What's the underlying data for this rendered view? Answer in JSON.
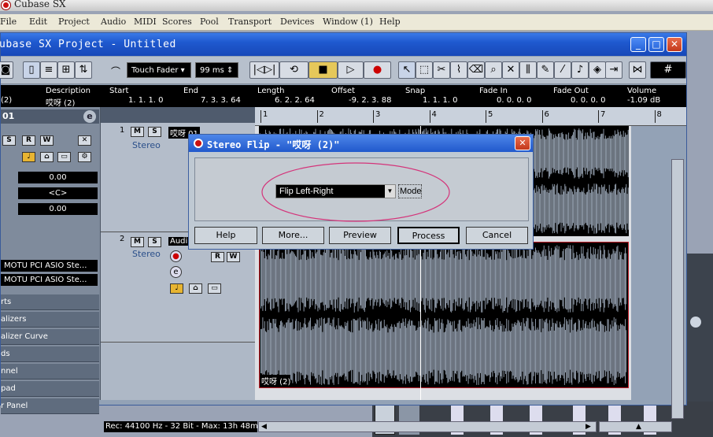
{
  "app": {
    "title": "Cubase SX"
  },
  "menu": [
    "File",
    "Edit",
    "Project",
    "Audio",
    "MIDI",
    "Scores",
    "Pool",
    "Transport",
    "Devices",
    "Window (1)",
    "Help"
  ],
  "project_window": {
    "title": "ubase SX Project - Untitled",
    "buttons": {
      "minimize": "_",
      "maximize": "□",
      "close": "✕"
    }
  },
  "toolbar": {
    "automation_mode": "Touch Fader",
    "auto_quantize": "99 ms",
    "icons": [
      "rewind-icon",
      "cycle-icon",
      "stop-icon",
      "play-icon",
      "record-icon",
      "pointer-icon",
      "range-icon",
      "split-icon",
      "glue-icon",
      "erase-icon",
      "zoom-icon",
      "mute-icon",
      "time-warp-icon",
      "draw-icon",
      "line-icon",
      "play-tool-icon",
      "color-icon",
      "snap-icon",
      "grid-icon"
    ]
  },
  "infoline": {
    "headers": {
      "description": "Description",
      "start": "Start",
      "end": "End",
      "length": "Length",
      "offset": "Offset",
      "snap": "Snap",
      "fade_in": "Fade In",
      "fade_out": "Fade Out",
      "volume": "Volume"
    },
    "values": {
      "id": "(2)",
      "description": "哎呀 (2)",
      "start": "1. 1. 1. 0",
      "end": "7. 3. 3. 64",
      "length": "6. 2. 2. 64",
      "offset": "-9. 2. 3. 88",
      "snap": "1. 1. 1. 0",
      "fade_in": "0. 0. 0. 0",
      "fade_out": "0. 0. 0. 0",
      "volume": "-1.09 dB"
    }
  },
  "inspector": {
    "track_number": "01",
    "fader_values": [
      "0.00",
      "<C>",
      "0.00"
    ],
    "outputs": [
      "MOTU PCI ASIO Ste...",
      "MOTU PCI ASIO Ste..."
    ],
    "sections": [
      "rts",
      "alizers",
      "alizer Curve",
      "ds",
      "nnel",
      "pad",
      "r Panel"
    ]
  },
  "tracks": [
    {
      "number": "1",
      "type": "Stereo",
      "name": "哎呀 01"
    },
    {
      "number": "2",
      "type": "Stereo",
      "name": "Audi"
    }
  ],
  "ruler": {
    "bars": [
      "1",
      "2",
      "3",
      "4",
      "5",
      "6",
      "7",
      "8"
    ]
  },
  "event": {
    "name": "哎呀 (2)"
  },
  "dialog": {
    "title": "Stereo Flip - \"哎呀 (2)\"",
    "mode_value": "Flip Left-Right",
    "mode_label": "Mode",
    "buttons": {
      "help": "Help",
      "more": "More...",
      "preview": "Preview",
      "process": "Process",
      "cancel": "Cancel"
    }
  },
  "status": {
    "text": "Rec: 44100 Hz - 32 Bit - Max: 13h 48mi"
  }
}
